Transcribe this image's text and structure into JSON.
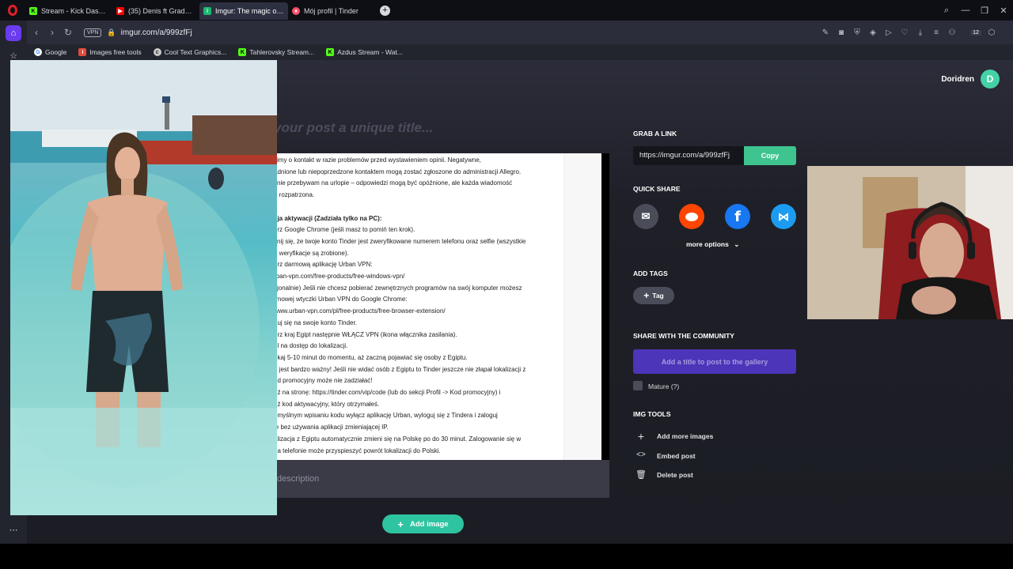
{
  "browser": {
    "tabs": [
      {
        "label": "Stream - Kick Dashboard",
        "favicon": "kick-icon",
        "color": "#53fc18"
      },
      {
        "label": "(35) Denis ft Gradu - F",
        "favicon": "youtube-icon",
        "color": "#ff0000"
      },
      {
        "label": "Imgur: The magic of the I",
        "favicon": "imgur-icon",
        "color": "#1bb76e"
      },
      {
        "label": "Mój profil | Tinder",
        "favicon": "tinder-icon",
        "color": "#fd5068"
      }
    ],
    "new_tab": "+",
    "url": "imgur.com/a/999zfFj",
    "vpn_badge": "VPN",
    "bookmarks": [
      {
        "label": "Google",
        "icon": "google-icon"
      },
      {
        "label": "Images free tools",
        "icon": "images-tools-icon"
      },
      {
        "label": "Cool Text Graphics...",
        "icon": "cooltext-icon"
      },
      {
        "label": "Tahlerovsky Stream...",
        "icon": "kick-icon"
      },
      {
        "label": "Azdus Stream - Wat...",
        "icon": "kick-icon"
      }
    ],
    "extension_badge": "12"
  },
  "page": {
    "user": {
      "name": "Doridren",
      "avatar_letter": "D",
      "avatar_color": "#45d1a6"
    },
    "title_placeholder": "your post a unique title...",
    "description_placeholder": "description",
    "add_image_label": "Add image",
    "document_lines": [
      {
        "text": "simy o kontakt w razie problemów przed wystawieniem opinii. Negatywne,",
        "bold": false
      },
      {
        "text": "adnione lub niepoprzedzone kontaktem mogą zostać zgłoszone do administracji Allegro.",
        "bold": false
      },
      {
        "text": "cnie przebywam na urlopie – odpowiedzi mogą być opóźnione, ale każda wiadomość",
        "bold": false
      },
      {
        "text": "e rozpatrzona.",
        "bold": false
      },
      {
        "text": "",
        "bold": false
      },
      {
        "text": "cja aktywacji (Zadziała tylko na PC):",
        "bold": true
      },
      {
        "text": "erz Google Chrome (jeśli masz to pomiń ten krok).",
        "bold": false
      },
      {
        "text": "ynij się, że twoje konto Tinder jest zweryfikowane numerem telefonu oraz selfie (wszystkie",
        "bold": false
      },
      {
        "text": "e weryfikacje są zrobione).",
        "bold": false
      },
      {
        "text": "erz darmową aplikację Urban VPN:",
        "bold": false
      },
      {
        "text": "rban-vpn.com/free-products/free-windows-vpn/",
        "bold": false
      },
      {
        "text": "cjonalnie) Jeśli nie chcesz pobierać zewnętrznych programów na swój komputer możesz",
        "bold": false
      },
      {
        "text": "rmowej wtyczki Urban VPN do Google Chrome:",
        "bold": false
      },
      {
        "text": "www.urban-vpn.com/pl/free-products/free-browser-extension/",
        "bold": false
      },
      {
        "text": "guj się na swoje konto Tinder.",
        "bold": false
      },
      {
        "text": "erz kraj Egipt następnie WŁĄCZ VPN (ikona włącznika zasilania).",
        "bold": false
      },
      {
        "text": "ól na dostęp do lokalizacji.",
        "bold": false
      },
      {
        "text": "ekaj 5-10 minut do momentu, aż zaczną pojawiać się osoby z Egiptu.",
        "bold": false
      },
      {
        "text": "n jest bardzo ważny! Jeśli nie widać osób z Egiptu to Tinder jeszcze nie złapał lokalizacji z",
        "bold": false
      },
      {
        "text": "od promocyjny może nie zadziałać!",
        "bold": false
      },
      {
        "text": "dź na stronę:  https://tinder.com/vip/code (lub do sekcji Profil -> Kod promocyjny) i",
        "bold": false
      },
      {
        "text": "dź kod aktywacyjny, który otrzymałeś.",
        "bold": false
      },
      {
        "text": "omyślnym wpisaniu kodu wyłącz aplikację Urban, wyloguj się z Tindera i zaloguj",
        "bold": false
      },
      {
        "text": "ie bez używania aplikacji zmieniającej IP.",
        "bold": false
      },
      {
        "text": "alizacja z Egiptu automatycznie zmieni się na Polskę po do 30 minut. Zalogowanie się w",
        "bold": false
      },
      {
        "text": " na telefonie może przyspieszyć powrót lokalizacji do Polski.",
        "bold": false
      }
    ]
  },
  "right_panel": {
    "grab_link_heading": "GRAB A LINK",
    "link_value": "https://imgur.com/a/999zfFj",
    "copy_label": "Copy",
    "quick_share_heading": "QUICK SHARE",
    "share_buttons": [
      {
        "name": "email-icon",
        "color": "#4a4c59",
        "glyph": "✉"
      },
      {
        "name": "reddit-icon",
        "color": "#ff4500",
        "glyph": "●"
      },
      {
        "name": "facebook-icon",
        "color": "#1877f2",
        "glyph": "f"
      },
      {
        "name": "bluesky-icon",
        "color": "#1d9bf0",
        "glyph": "🦋"
      }
    ],
    "more_options_label": "more options",
    "add_tags_heading": "ADD TAGS",
    "tag_button_label": "Tag",
    "community_heading": "SHARE WITH THE COMMUNITY",
    "gallery_button_label": "Add a title to post to the gallery",
    "mature_label": "Mature (?)",
    "img_tools_heading": "IMG TOOLS",
    "tools": [
      {
        "label": "Add more images",
        "icon": "plus-icon",
        "glyph": "+"
      },
      {
        "label": "Embed post",
        "icon": "code-icon",
        "glyph": "<>"
      },
      {
        "label": "Delete post",
        "icon": "trash-icon",
        "glyph": "🗑"
      }
    ]
  },
  "overlays": {
    "photo": "man-standing-in-sea-photo",
    "webcam": "streamer-webcam"
  }
}
